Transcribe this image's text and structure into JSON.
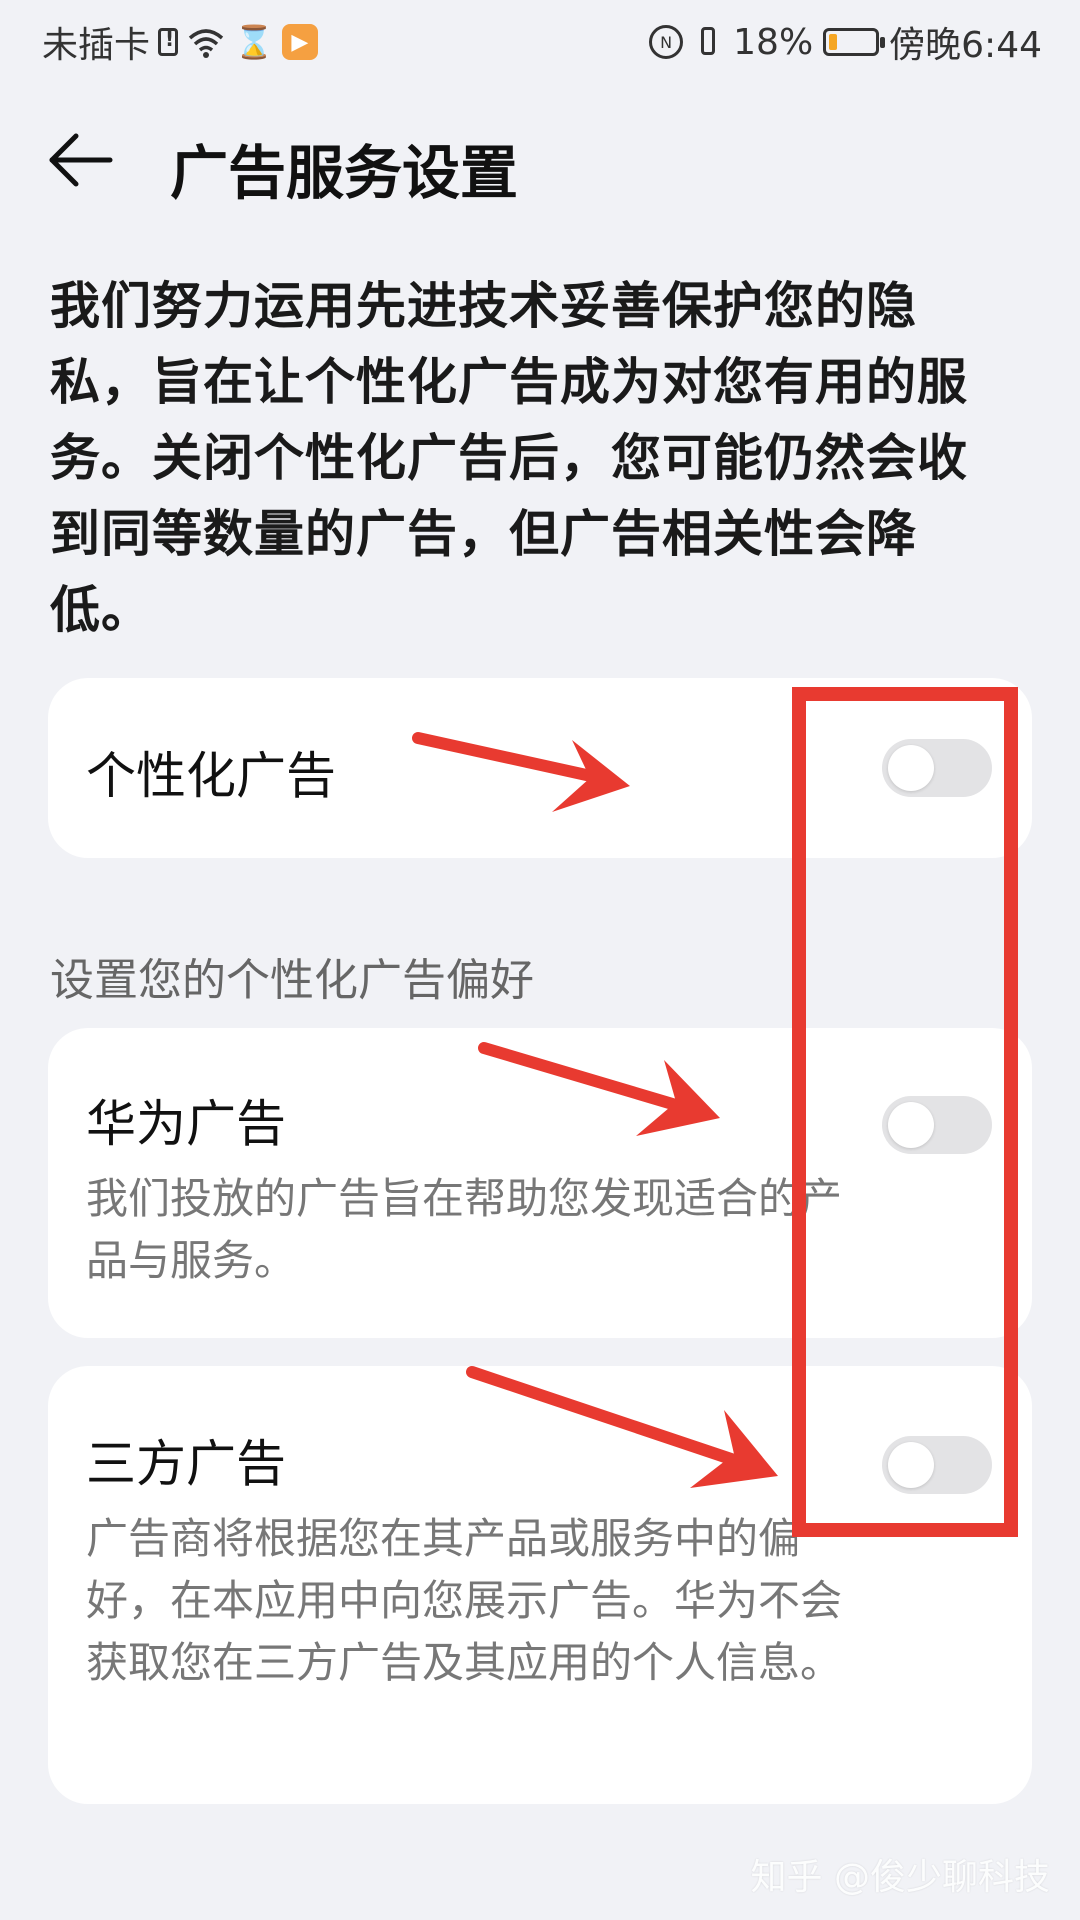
{
  "status_bar": {
    "carrier": "未插卡",
    "battery_percent": "18%",
    "battery_level": 0.18,
    "time": "傍晚6:44"
  },
  "header": {
    "back_icon": "arrow-left-icon",
    "title": "广告服务设置"
  },
  "description": "我们努力运用先进技术妥善保护您的隐私，旨在让个性化广告成为对您有用的服务。关闭个性化广告后，您可能仍然会收到同等数量的广告，但广告相关性会降低。",
  "personalized": {
    "label": "个性化广告",
    "enabled": false
  },
  "preferences_section": {
    "label": "设置您的个性化广告偏好",
    "items": [
      {
        "title": "华为广告",
        "description": "我们投放的广告旨在帮助您发现适合的产品与服务。",
        "enabled": false
      },
      {
        "title": "三方广告",
        "description": "广告商将根据您在其产品或服务中的偏好，在本应用中向您展示广告。华为不会获取您在三方广告及其应用的个人信息。",
        "enabled": false
      }
    ]
  },
  "annotation": {
    "color": "#e83a30"
  },
  "watermark": "知乎 @俊少聊科技",
  "colors": {
    "background": "#f1f2f6",
    "card": "#ffffff",
    "toggle_off": "#e3e3e5"
  }
}
